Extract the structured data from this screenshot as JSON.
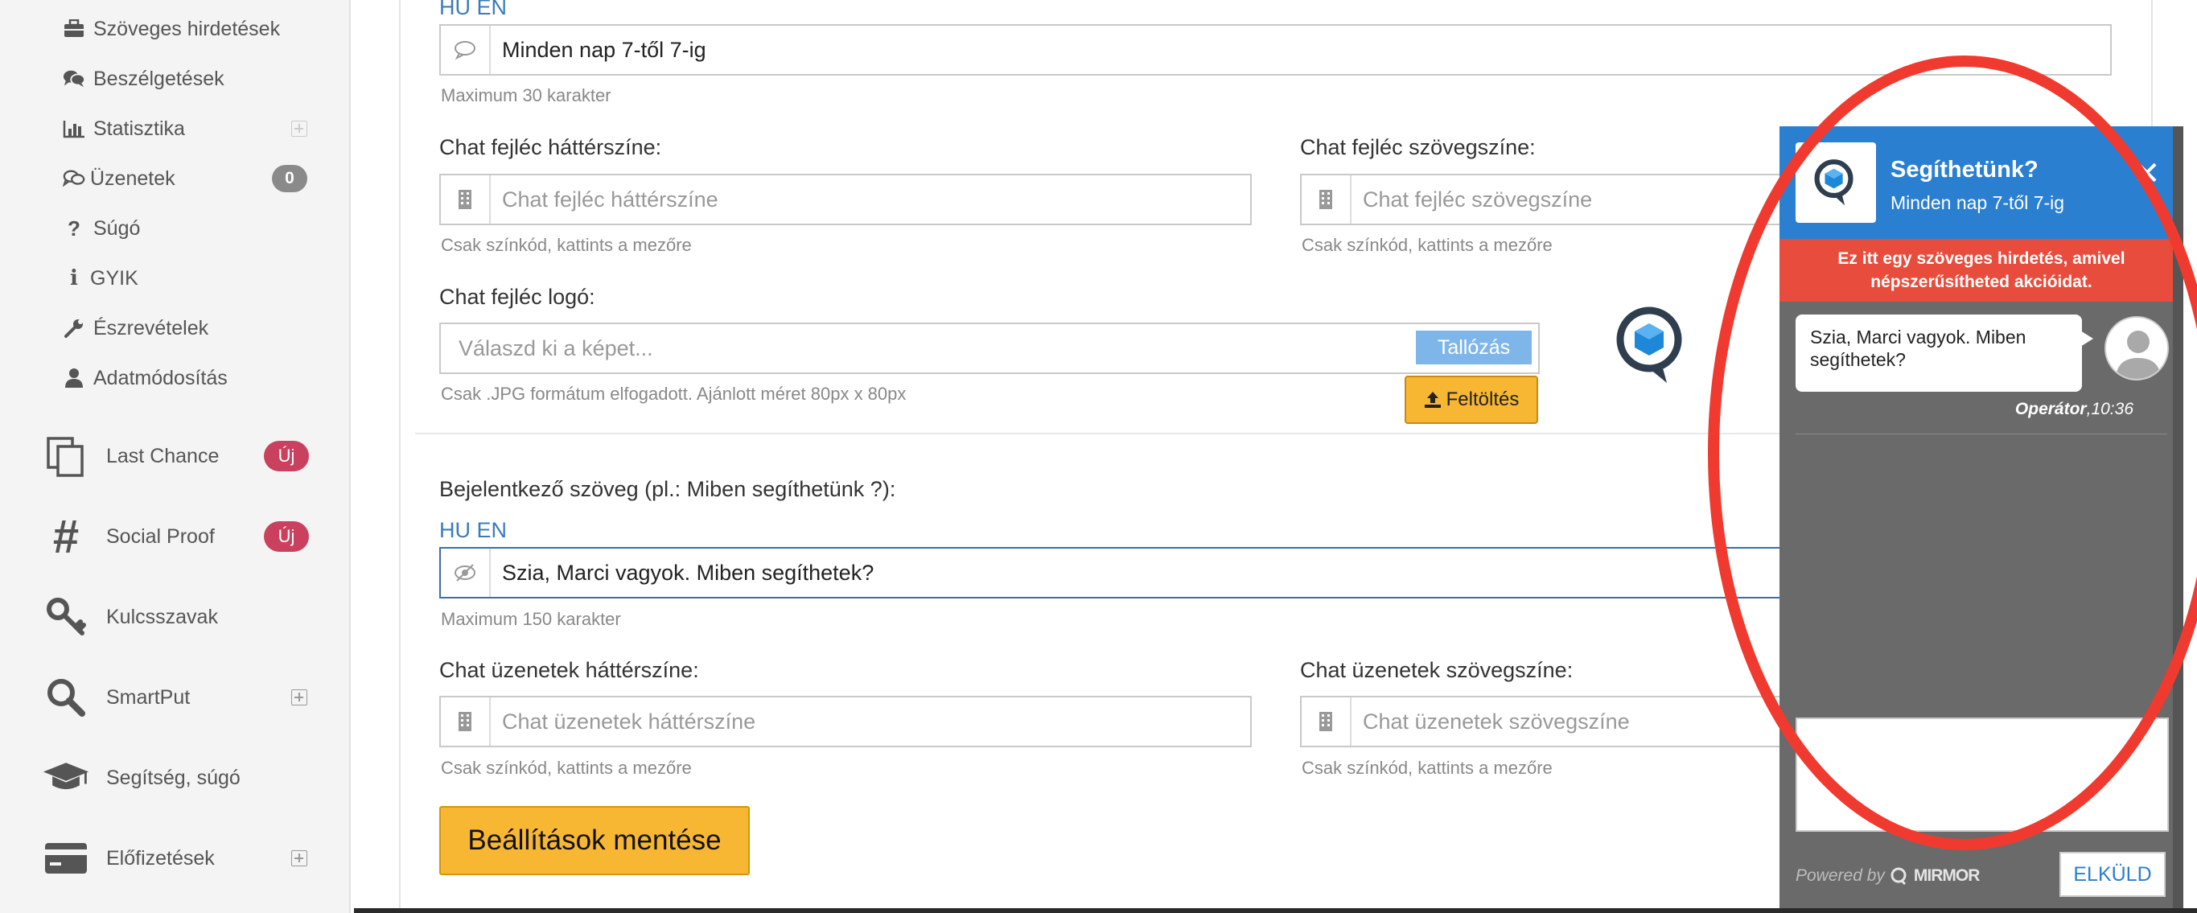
{
  "sidebar": {
    "small_items": [
      {
        "label": "Szöveges hirdetések",
        "icon": "briefcase-icon"
      },
      {
        "label": "Beszélgetések",
        "icon": "comments-icon"
      },
      {
        "label": "Statisztika",
        "icon": "bar-chart-icon"
      },
      {
        "label": "Üzenetek",
        "icon": "messages-icon",
        "badge": "0"
      },
      {
        "label": "Súgó",
        "icon": "question-icon"
      },
      {
        "label": "GYIK",
        "icon": "info-icon"
      },
      {
        "label": "Észrevételek",
        "icon": "wrench-icon"
      },
      {
        "label": "Adatmódosítás",
        "icon": "user-icon"
      }
    ],
    "big_items": [
      {
        "label": "Last Chance",
        "icon": "copy-icon",
        "badge": "Új"
      },
      {
        "label": "Social Proof",
        "icon": "hash-icon",
        "badge": "Új"
      },
      {
        "label": "Kulcsszavak",
        "icon": "key-icon"
      },
      {
        "label": "SmartPut",
        "icon": "search-icon"
      },
      {
        "label": "Segítség, súgó",
        "icon": "graduation-cap-icon"
      },
      {
        "label": "Előfizetések",
        "icon": "credit-card-icon"
      }
    ]
  },
  "form": {
    "lang_top": "HU EN",
    "subtitle_value": "Minden nap 7-től 7-ig",
    "subtitle_hint": "Maximum 30 karakter",
    "header_bg_label": "Chat fejléc háttérszíne:",
    "header_bg_placeholder": "Chat fejléc háttérszíne",
    "header_text_label": "Chat fejléc szövegszíne:",
    "header_text_placeholder": "Chat fejléc szövegszíne",
    "color_hint": "Csak színkód, kattints a mezőre",
    "logo_label": "Chat fejléc logó:",
    "logo_placeholder": "Válaszd ki a képet...",
    "browse_label": "Tallózás",
    "upload_label": "Feltöltés",
    "logo_hint": "Csak .JPG formátum elfogadott. Ajánlott méret 80px x 80px",
    "greeting_label": "Bejelentkező szöveg (pl.: Miben segíthetünk ?):",
    "lang_greeting": "HU EN",
    "greeting_value": "Szia, Marci vagyok. Miben segíthetek?",
    "greeting_hint": "Maximum 150 karakter",
    "msg_bg_label": "Chat üzenetek háttérszíne:",
    "msg_bg_placeholder": "Chat üzenetek háttérszíne",
    "msg_text_label": "Chat üzenetek szövegszíne:",
    "msg_text_placeholder": "Chat üzenetek szövegszíne",
    "save_label": "Beállítások mentése"
  },
  "widget": {
    "title": "Segíthetünk?",
    "subtitle": "Minden nap 7-től 7-ig",
    "close": "✕",
    "ad_text": "Ez itt egy szöveges hirdetés, amivel népszerűsítheted akcióidat.",
    "message": "Szia, Marci vagyok. Miben segíthetek?",
    "operator": "Operátor",
    "time": ",10:36",
    "powered_by": "Powered by",
    "brand": "MIRMOR",
    "send_label": "ELKÜLD"
  },
  "colors": {
    "accent_blue": "#2b7fd1",
    "ad_red": "#e74c3c",
    "button_orange": "#f7b733",
    "badge_red": "#c9415f",
    "annotation_red": "#f03a2f"
  }
}
